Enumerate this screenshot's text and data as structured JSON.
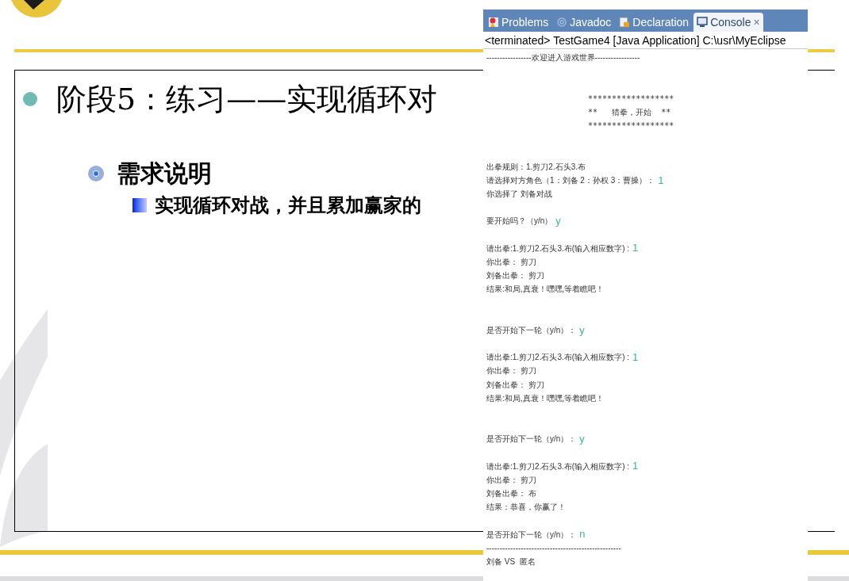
{
  "slide": {
    "title": "阶段5：练习——实现循环对",
    "subheading": "需求说明",
    "point": "实现循环对战，并且累加赢家的"
  },
  "console": {
    "tabs": [
      {
        "label": "Problems",
        "selected": false
      },
      {
        "label": "Javadoc",
        "selected": false
      },
      {
        "label": "Declaration",
        "selected": false
      },
      {
        "label": "Console",
        "selected": true,
        "close": "×"
      }
    ],
    "header": "<terminated> TestGame4 [Java Application] C:\\usr\\MyEclipse",
    "lines": [
      {
        "kind": "plain",
        "text": "-----------------欢迎进入游戏世界-----------------"
      },
      {
        "kind": "blank"
      },
      {
        "kind": "blank"
      },
      {
        "kind": "banner",
        "text": "******************"
      },
      {
        "kind": "banner",
        "text": "**   猜拳，开始  **"
      },
      {
        "kind": "banner",
        "text": "******************"
      },
      {
        "kind": "blank"
      },
      {
        "kind": "blank"
      },
      {
        "kind": "plain",
        "text": "出拳规则：1.剪刀2.石头3.布"
      },
      {
        "kind": "plain",
        "text": "请选择对方角色（1：刘备 2：孙权 3：曹操）：",
        "input": "1"
      },
      {
        "kind": "plain",
        "text": "你选择了 刘备对战"
      },
      {
        "kind": "blank"
      },
      {
        "kind": "plain",
        "text": "要开始吗？（y/n）",
        "input": "y"
      },
      {
        "kind": "blank"
      },
      {
        "kind": "plain",
        "text": "请出拳:1.剪刀2.石头3.布(输入相应数字) :",
        "input": "1"
      },
      {
        "kind": "plain",
        "text": "你出拳： 剪刀"
      },
      {
        "kind": "plain",
        "text": "刘备出拳： 剪刀"
      },
      {
        "kind": "plain",
        "text": "结果:和局,真衰！嘿嘿,等着瞧吧！"
      },
      {
        "kind": "blank"
      },
      {
        "kind": "blank"
      },
      {
        "kind": "plain",
        "text": "是否开始下一轮（y/n）：",
        "input": "y"
      },
      {
        "kind": "blank"
      },
      {
        "kind": "plain",
        "text": "请出拳:1.剪刀2.石头3.布(输入相应数字) :",
        "input": "1"
      },
      {
        "kind": "plain",
        "text": "你出拳： 剪刀"
      },
      {
        "kind": "plain",
        "text": "刘备出拳： 剪刀"
      },
      {
        "kind": "plain",
        "text": "结果:和局,真衰！嘿嘿,等着瞧吧！"
      },
      {
        "kind": "blank"
      },
      {
        "kind": "blank"
      },
      {
        "kind": "plain",
        "text": "是否开始下一轮（y/n）：",
        "input": "y"
      },
      {
        "kind": "blank"
      },
      {
        "kind": "plain",
        "text": "请出拳:1.剪刀2.石头3.布(输入相应数字) :",
        "input": "1"
      },
      {
        "kind": "plain",
        "text": "你出拳： 剪刀"
      },
      {
        "kind": "plain",
        "text": "刘备出拳： 布"
      },
      {
        "kind": "plain",
        "text": "结果：恭喜，你赢了！"
      },
      {
        "kind": "blank"
      },
      {
        "kind": "plain",
        "text": "是否开始下一轮（y/n）：",
        "input": "n"
      },
      {
        "kind": "plain",
        "text": "---------------------------------------------------"
      },
      {
        "kind": "plain",
        "text": "刘备 VS  匿名"
      }
    ]
  }
}
